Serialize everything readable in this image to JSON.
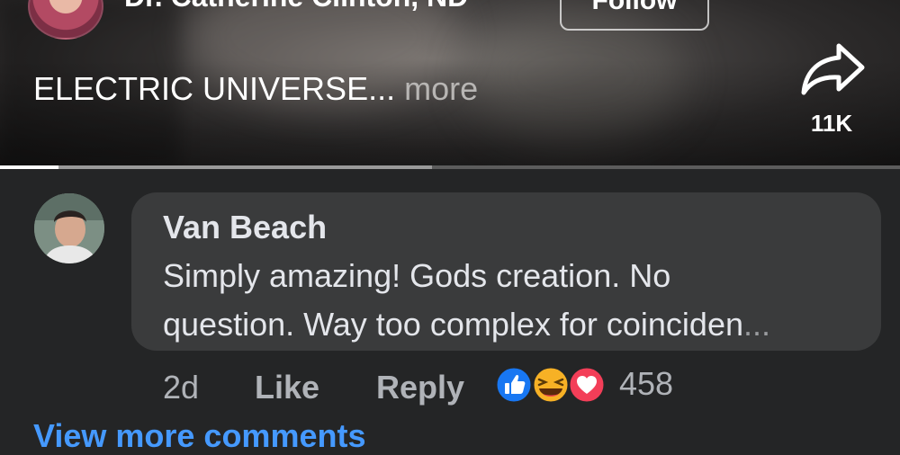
{
  "post": {
    "author_name": "Dr. Catherine Clinton, ND",
    "follow_label": "Follow",
    "caption": "ELECTRIC UNIVERSE...",
    "more_label": "more",
    "share_count": "11K",
    "playback_progress_fraction": 0.065,
    "buffer_progress_fraction": 0.48
  },
  "comment": {
    "author": "Van Beach",
    "line1": "Simply amazing! Gods creation. No",
    "line2": "question. Way too complex for coinciden",
    "ellipsis": "...",
    "age": "2d",
    "like_label": "Like",
    "reply_label": "Reply",
    "reaction_count": "458",
    "reactions": [
      "like-icon",
      "haha-icon",
      "love-icon"
    ]
  },
  "view_more": "View more comments",
  "colors": {
    "background": "#242526",
    "bubble": "#3a3b3c",
    "link_blue": "#4599ff",
    "like_blue": "#1877f2",
    "love_red": "#f33e58",
    "haha_yellow": "#f7b125"
  }
}
